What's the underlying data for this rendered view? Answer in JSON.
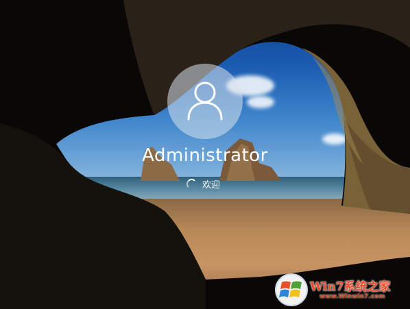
{
  "user": {
    "name": "Administrator",
    "avatar_icon": "user-icon"
  },
  "status": {
    "text": "欢迎",
    "spinner_icon": "loading-spinner-icon"
  },
  "watermark": {
    "title": "Win7系统之家",
    "url": "www.Winwin7.com",
    "logo_icon": "windows-logo-icon"
  },
  "colors": {
    "text": "#ffffff",
    "watermark_red": "#e84a2c"
  }
}
